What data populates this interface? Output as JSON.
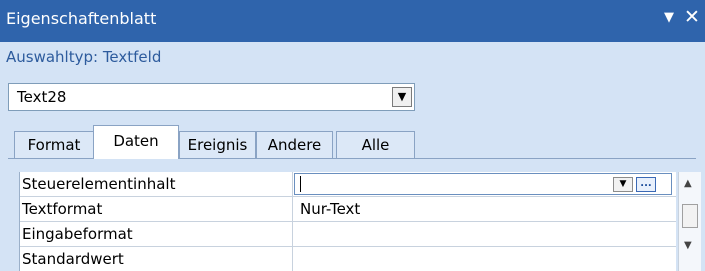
{
  "window": {
    "title": "Eigenschaftenblatt",
    "menu_glyph": "▼",
    "close_glyph": "✕"
  },
  "selection": {
    "type_label": "Auswahltyp: Textfeld"
  },
  "object_selector": {
    "value": "Text28",
    "dropdown_glyph": "▼"
  },
  "tabs": [
    {
      "label": "Format"
    },
    {
      "label": "Daten"
    },
    {
      "label": "Ereignis"
    },
    {
      "label": "Andere"
    },
    {
      "label": "Alle"
    }
  ],
  "active_tab": "Daten",
  "properties": [
    {
      "name": "Steuerelementinhalt",
      "value": ""
    },
    {
      "name": "Textformat",
      "value": "Nur-Text"
    },
    {
      "name": "Eingabeformat",
      "value": ""
    },
    {
      "name": "Standardwert",
      "value": ""
    }
  ],
  "editor_buttons": {
    "dropdown_glyph": "▼",
    "build_glyph": "..."
  },
  "scrollbar": {
    "up_glyph": "▲",
    "down_glyph": "▼"
  },
  "colors": {
    "titlebar": "#2f64ac",
    "pane": "#d4e3f5",
    "selection_text": "#2d5b9d"
  }
}
